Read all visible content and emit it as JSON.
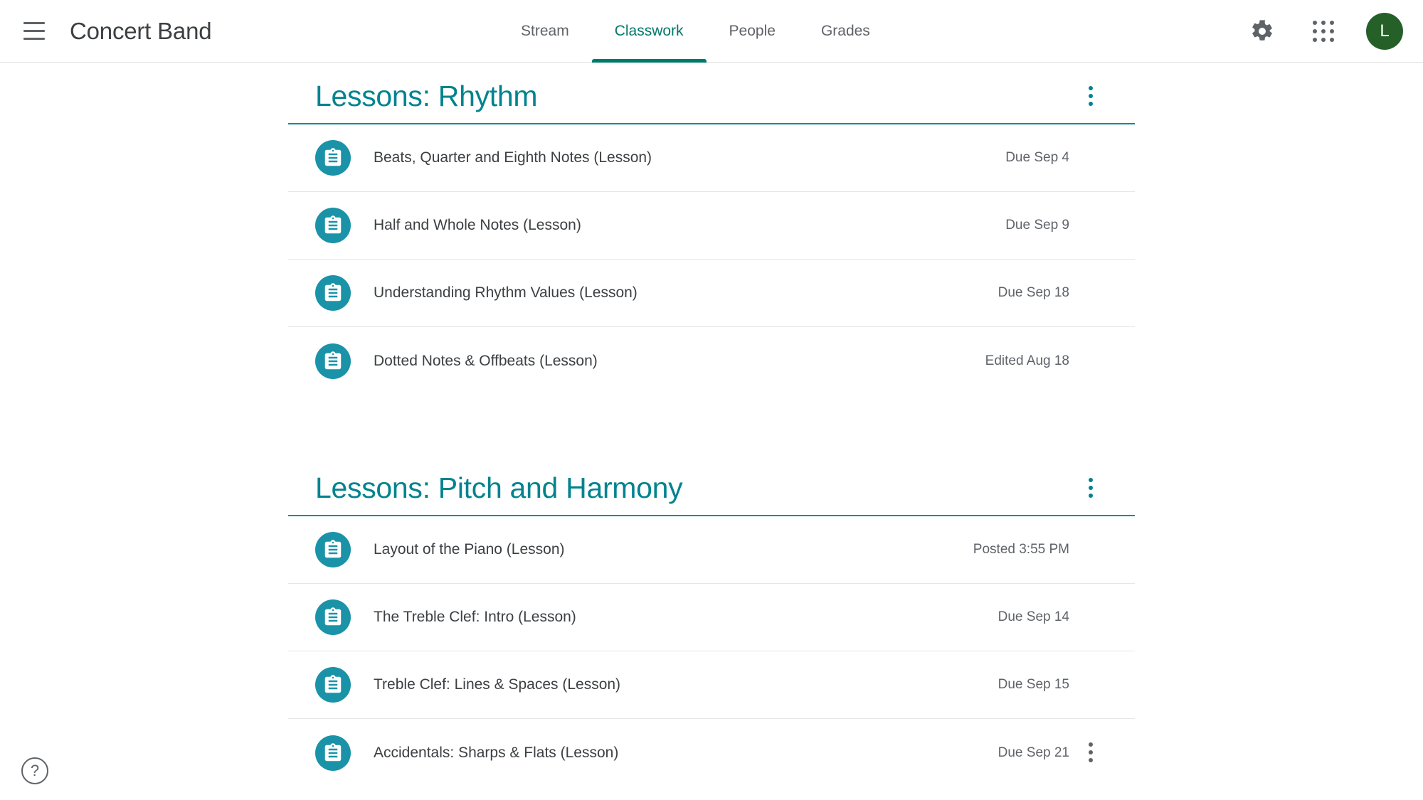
{
  "appbar": {
    "menu_label": "Main menu",
    "course_title": "Concert Band",
    "settings_icon": "gear-icon",
    "apps_icon": "apps-grid-icon",
    "avatar_initial": "L",
    "tabs": [
      {
        "label": "Stream",
        "active": false
      },
      {
        "label": "Classwork",
        "active": true
      },
      {
        "label": "People",
        "active": false
      },
      {
        "label": "Grades",
        "active": false
      }
    ]
  },
  "colors": {
    "accent_teal": "#00838f",
    "tab_active": "#00796b",
    "icon_circle": "#1a93a8",
    "avatar_bg": "#256029",
    "text_primary": "#3c4043",
    "text_secondary": "#5f6368",
    "divider": "#e6e6e6"
  },
  "topics": [
    {
      "title": "Lessons: Rhythm",
      "items": [
        {
          "title": "Beats, Quarter and Eighth Notes (Lesson)",
          "meta": "Due Sep 4",
          "icon": "assignment-icon",
          "kebab": false
        },
        {
          "title": "Half and Whole Notes (Lesson)",
          "meta": "Due Sep 9",
          "icon": "assignment-icon",
          "kebab": false
        },
        {
          "title": "Understanding Rhythm Values (Lesson)",
          "meta": "Due Sep 18",
          "icon": "assignment-icon",
          "kebab": false
        },
        {
          "title": "Dotted Notes & Offbeats (Lesson)",
          "meta": "Edited Aug 18",
          "icon": "assignment-icon",
          "kebab": false
        }
      ]
    },
    {
      "title": "Lessons: Pitch and Harmony",
      "items": [
        {
          "title": "Layout of the Piano (Lesson)",
          "meta": "Posted 3:55 PM",
          "icon": "assignment-icon",
          "kebab": false
        },
        {
          "title": "The Treble Clef: Intro (Lesson)",
          "meta": "Due Sep 14",
          "icon": "assignment-icon",
          "kebab": false
        },
        {
          "title": "Treble Clef: Lines & Spaces (Lesson)",
          "meta": "Due Sep 15",
          "icon": "assignment-icon",
          "kebab": false
        },
        {
          "title": "Accidentals: Sharps & Flats (Lesson)",
          "meta": "Due Sep 21",
          "icon": "assignment-icon",
          "kebab": true
        }
      ]
    }
  ],
  "help": {
    "label": "?"
  }
}
